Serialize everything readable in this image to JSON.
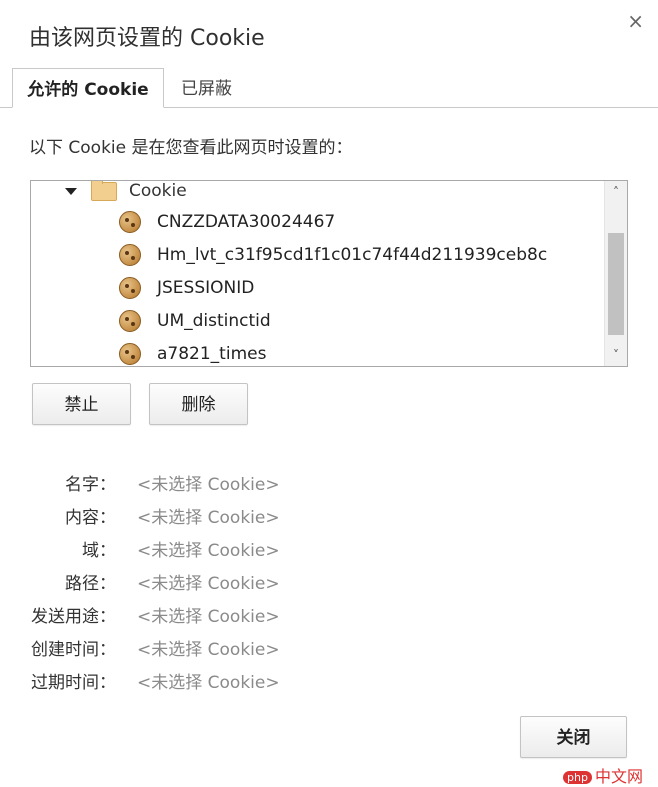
{
  "dialog": {
    "title": "由该网页设置的 Cookie",
    "close_glyph": "×"
  },
  "tabs": [
    {
      "label": "允许的 Cookie",
      "active": true
    },
    {
      "label": "已屏蔽",
      "active": false
    }
  ],
  "description": "以下 Cookie 是在您查看此网页时设置的：",
  "tree": {
    "folder_label": "Cookie",
    "items": [
      {
        "label": "CNZZDATA30024467"
      },
      {
        "label": "Hm_lvt_c31f95cd1f1c01c74f44d211939ceb8c"
      },
      {
        "label": "JSESSIONID"
      },
      {
        "label": "UM_distinctid"
      },
      {
        "label": "a7821_times"
      }
    ],
    "scroll": {
      "up_glyph": "˄",
      "down_glyph": "˅"
    }
  },
  "buttons": {
    "block": "禁止",
    "delete": "删除",
    "close": "关闭"
  },
  "details": [
    {
      "label": "名字：",
      "value": "<未选择 Cookie>"
    },
    {
      "label": "内容：",
      "value": "<未选择 Cookie>"
    },
    {
      "label": "域：",
      "value": "<未选择 Cookie>"
    },
    {
      "label": "路径：",
      "value": "<未选择 Cookie>"
    },
    {
      "label": "发送用途：",
      "value": "<未选择 Cookie>"
    },
    {
      "label": "创建时间：",
      "value": "<未选择 Cookie>"
    },
    {
      "label": "过期时间：",
      "value": "<未选择 Cookie>"
    }
  ],
  "watermark": {
    "badge": "php",
    "text": "中文网"
  },
  "colors": {
    "muted_value": "#8a8a8a",
    "border": "#c9c9c9"
  }
}
